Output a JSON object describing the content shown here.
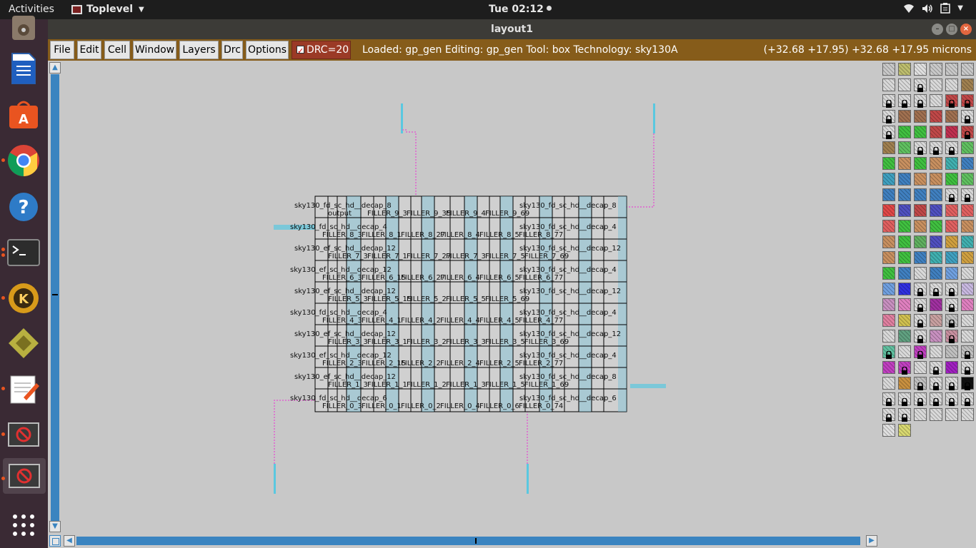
{
  "topbar": {
    "activities": "Activities",
    "app_name": "Toplevel",
    "clock": "Tue 02:12"
  },
  "dock": {
    "items": [
      {
        "icon": "disk-icon"
      },
      {
        "icon": "document-viewer-icon"
      },
      {
        "icon": "software-center-icon"
      },
      {
        "icon": "chrome-icon"
      },
      {
        "icon": "help-icon"
      },
      {
        "icon": "terminal-icon"
      },
      {
        "icon": "klayout-icon"
      },
      {
        "icon": "xschem-icon"
      },
      {
        "icon": "text-editor-icon"
      },
      {
        "icon": "blocked-app-icon"
      },
      {
        "icon": "blocked-app-icon"
      },
      {
        "icon": "show-apps-icon"
      }
    ]
  },
  "window": {
    "title": "layout1"
  },
  "menubar": {
    "items": [
      "File",
      "Edit",
      "Cell",
      "Window",
      "Layers",
      "Drc",
      "Options"
    ],
    "drc": "DRC=20",
    "status": "Loaded: gp_gen Editing: gp_gen Tool: box  Technology: sky130A",
    "coords": "(+32.68 +17.95) +32.68 +17.95 microns"
  },
  "layout": {
    "rows": [
      {
        "left": "sky130_fd_sc_hd__decap_8",
        "right": "sky130_fd_sc_hd__decap_8",
        "fillers": [
          "output",
          "FILLER_9_3",
          "FILLER_9_35",
          "FILLER_9_4",
          "FILLER_9_69"
        ]
      },
      {
        "left": "sky130_fd_sc_hd__decap_4",
        "right": "sky130_fd_sc_hd__decap_4",
        "fillers": [
          "FILLER_8_3",
          "FILLER_8_1",
          "FILLER_8_27",
          "FILLER_8_4",
          "FILLER_8_5",
          "FILLER_8_77"
        ]
      },
      {
        "left": "sky130_ef_sc_hd__decap_12",
        "right": "sky130_fd_sc_hd__decap_12",
        "fillers": [
          "FILLER_7_3",
          "FILLER_7_1",
          "FILLER_7_27",
          "FILLER_7_3",
          "FILLER_7_5",
          "FILLER_7_69"
        ]
      },
      {
        "left": "sky130_ef_sc_hd__decap_12",
        "right": "sky130_fd_sc_hd__decap_4",
        "fillers": [
          "FILLER_6_3",
          "FILLER_6_15",
          "FILLER_6_27",
          "FILLER_6_4",
          "FILLER_6_5",
          "FILLER_6_77"
        ]
      },
      {
        "left": "sky130_ef_sc_hd__decap_12",
        "right": "sky130_fd_sc_hd__decap_12",
        "fillers": [
          "FILLER_5_3",
          "FILLER_5_15",
          "FILLER_5_2",
          "FILLER_5_5",
          "FILLER_5_69"
        ]
      },
      {
        "left": "sky130_fd_sc_hd__decap_4",
        "right": "sky130_fd_sc_hd__decap_4",
        "fillers": [
          "FILLER_4_3",
          "FILLER_4_1",
          "FILLER_4_2",
          "FILLER_4_4",
          "FILLER_4_5",
          "FILLER_4_77"
        ]
      },
      {
        "left": "sky130_ef_sc_hd__decap_12",
        "right": "sky130_fd_sc_hd__decap_12",
        "fillers": [
          "FILLER_3_3",
          "FILLER_3_1",
          "FILLER_3_2",
          "FILLER_3_3",
          "FILLER_3_5",
          "FILLER_3_69"
        ]
      },
      {
        "left": "sky130_ef_sc_hd__decap_12",
        "right": "sky130_fd_sc_hd__decap_4",
        "fillers": [
          "FILLER_2_3",
          "FILLER_2_15",
          "FILLER_2_2",
          "FILLER_2_4",
          "FILLER_2_5",
          "FILLER_2_77"
        ]
      },
      {
        "left": "sky130_ef_sc_hd__decap_12",
        "right": "sky130_fd_sc_hd__decap_8",
        "fillers": [
          "FILLER_1_3",
          "FILLER_1_1",
          "FILLER_1_2",
          "FILLER_1_3",
          "FILLER_1_5",
          "FILLER_1_69"
        ]
      },
      {
        "left": "sky130_fd_sc_hd__decap_6",
        "right": "sky130_fd_sc_hd__decap_6",
        "fillers": [
          "FILLER_0_3",
          "FILLER_0_1",
          "FILLER_0_2",
          "FILLER_0_4",
          "FILLER_0_6",
          "FILLER_0_74"
        ]
      }
    ]
  },
  "palette": {
    "colors": [
      "#c9c9c9",
      "#bdbd6e",
      "#e0e0e0",
      "#c9c9c9",
      "#c9c9c9",
      "#c9c9c9",
      "#d9d9d9",
      "#d9d9d9",
      "#d9d9d9",
      "#d9d9d9",
      "#d9d9d9",
      "#a08050",
      "#d9d9d9",
      "#d9d9d9",
      "#d9d9d9",
      "#d9d9d9",
      "#c04848",
      "#c04848",
      "#d9d9d9",
      "#a07050",
      "#a07050",
      "#c04848",
      "#a07050",
      "#d9d9d9",
      "#d9d9d9",
      "#40c040",
      "#40c040",
      "#c04848",
      "#c03050",
      "#c04848",
      "#a08050",
      "#60c060",
      "#d9d9d9",
      "#d9d9d9",
      "#d9d9d9",
      "#60c060",
      "#40c040",
      "#c89060",
      "#40c040",
      "#c89060",
      "#40b0b0",
      "#4080c0",
      "#40a0c0",
      "#4080c0",
      "#c89060",
      "#c89060",
      "#40c040",
      "#60c060",
      "#4080c0",
      "#4080c0",
      "#4080c0",
      "#4080c0",
      "#d9d9d9",
      "#d9d9d9",
      "#e04848",
      "#5050c0",
      "#c04848",
      "#5050c0",
      "#e06060",
      "#e06060",
      "#e06060",
      "#40c040",
      "#c89060",
      "#40c040",
      "#e06060",
      "#c89060",
      "#c89060",
      "#40c040",
      "#60b060",
      "#5050c0",
      "#d0a040",
      "#40b0b0",
      "#c89060",
      "#40c040",
      "#4080c0",
      "#40b0b0",
      "#40a0c0",
      "#d0a040",
      "#40c040",
      "#4080c0",
      "#d9d9d9",
      "#4080c0",
      "#70a0e0",
      "#d9d9d9",
      "#70a0e0",
      "#3030e0",
      "#d9d9d9",
      "#d9d9d9",
      "#d9d9d9",
      "#c8b8e0",
      "#c890c0",
      "#e080c0",
      "#d9d9d9",
      "#a030a0",
      "#d9d9d9",
      "#e080c0",
      "#e080a0",
      "#d0c050",
      "#d9d9d9",
      "#c8a0a0",
      "#c0c0c0",
      "#d9d9d9",
      "#d9d9d9",
      "#60a080",
      "#d9d9d9",
      "#c890c0",
      "#c890a0",
      "#d9d9d9",
      "#60c0a0",
      "#d9d9d9",
      "#c040c0",
      "#d9d9d9",
      "#c0c0c0",
      "#c0c0c0",
      "#c040c0",
      "#c040c0",
      "#d9d9d9",
      "#d9d9d9",
      "#a020c0",
      "#d9d9d9",
      "#d9d9d9",
      "#c89040",
      "#c0c0c0",
      "#d9d9d9",
      "#d9d9d9",
      "#101010",
      "#d9d9d9",
      "#d9d9d9",
      "#d9d9d9",
      "#d9d9d9",
      "#d9d9d9",
      "#d9d9d9",
      "#d9d9d9",
      "#d9d9d9",
      "#d9d9d9",
      "#d9d9d9",
      "#d9d9d9",
      "#d9d9d9",
      "#e0e0e0",
      "#d8d870"
    ]
  }
}
